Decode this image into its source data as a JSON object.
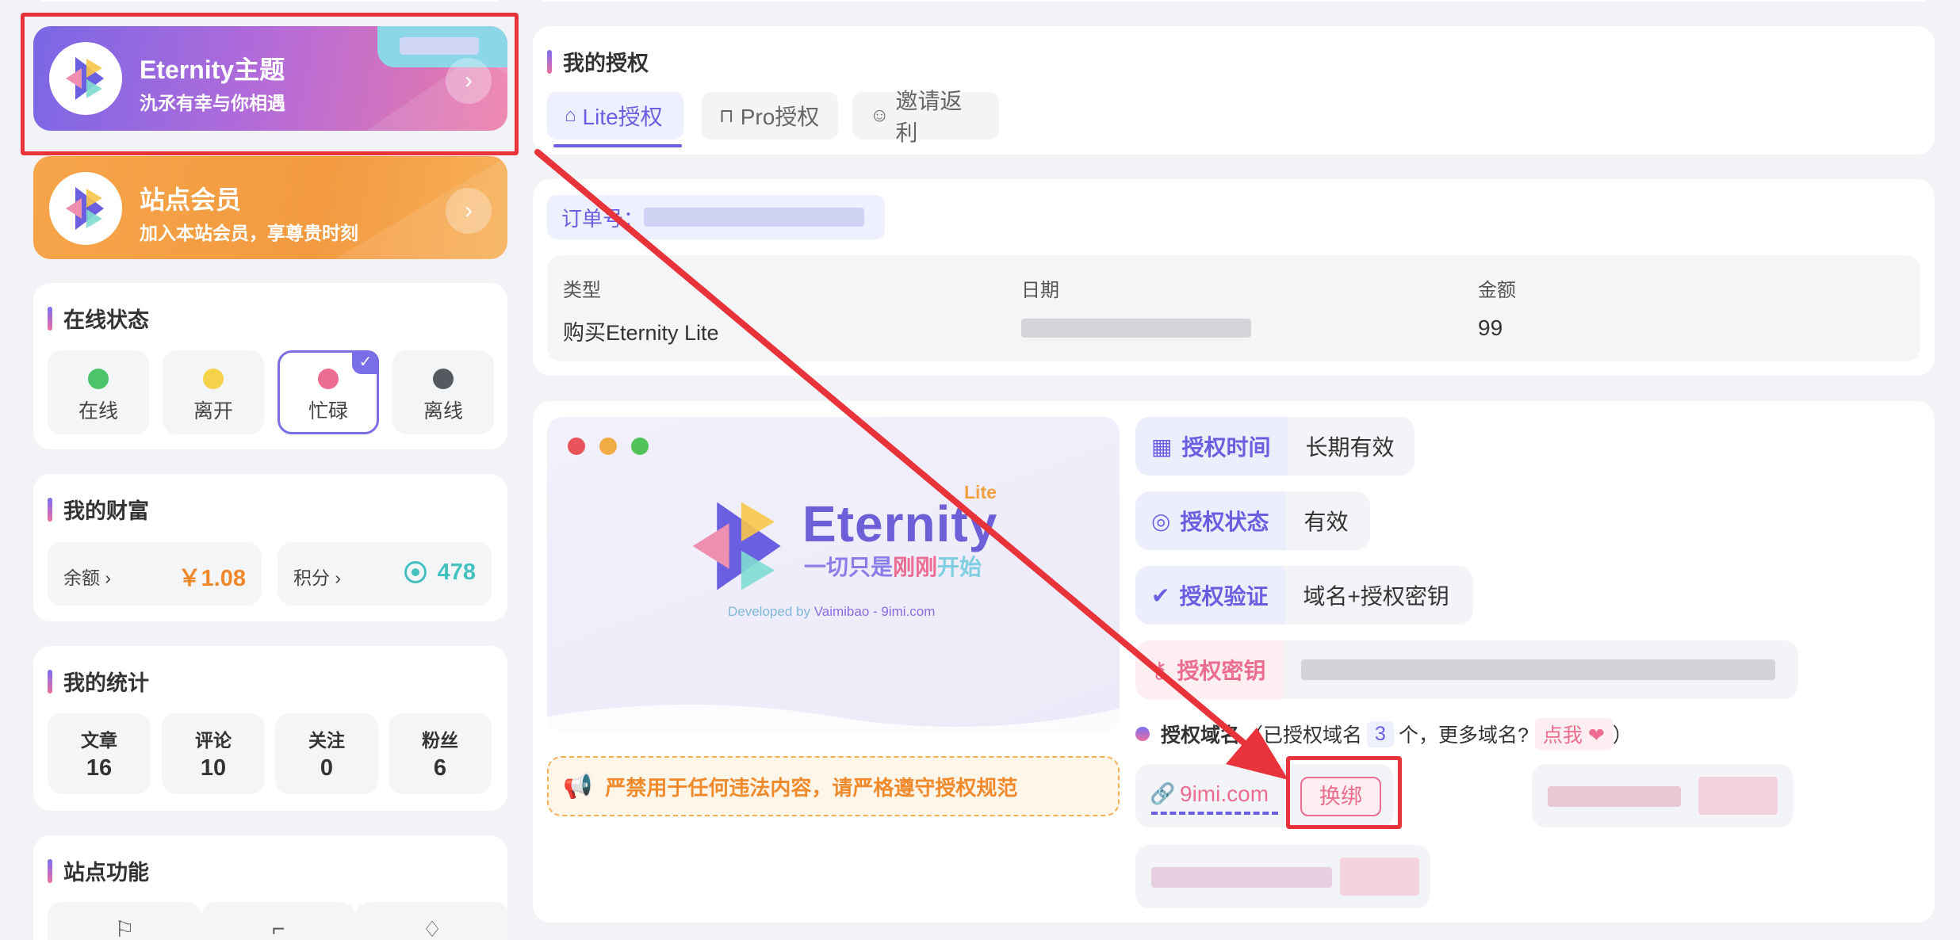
{
  "left": {
    "theme_card": {
      "title": "Eternity主题",
      "subtitle": "氿氶有幸与你相遇",
      "go": "›"
    },
    "member_card": {
      "title": "站点会员",
      "subtitle": "加入本站会员，享尊贵时刻",
      "go": "›"
    },
    "online_status": {
      "title": "在线状态",
      "items": [
        {
          "label": "在线",
          "color": "#4cc46a"
        },
        {
          "label": "离开",
          "color": "#f6d24a"
        },
        {
          "label": "忙碌",
          "color": "#ec6c92"
        },
        {
          "label": "离线",
          "color": "#555a60"
        }
      ]
    },
    "wealth": {
      "title": "我的财富",
      "balance_label": "余额 ›",
      "balance_value": "￥1.08",
      "points_label": "积分 ›",
      "points_value": "478"
    },
    "stats": {
      "title": "我的统计",
      "items": [
        {
          "label": "文章",
          "value": "16"
        },
        {
          "label": "评论",
          "value": "10"
        },
        {
          "label": "关注",
          "value": "0"
        },
        {
          "label": "粉丝",
          "value": "6"
        }
      ]
    },
    "functions": {
      "title": "站点功能"
    }
  },
  "right": {
    "auth_title": "我的授权",
    "tabs": [
      {
        "label": "Lite授权",
        "active": true
      },
      {
        "label": "Pro授权",
        "active": false
      },
      {
        "label": "邀请返利",
        "active": false
      }
    ],
    "order": {
      "label": "订单号：",
      "headers": [
        "类型",
        "日期",
        "金额"
      ],
      "row": {
        "type": "购买Eternity Lite",
        "amount": "99"
      }
    },
    "preview": {
      "brand": "Eternity",
      "edition": "Lite",
      "tagline_a": "一切只是",
      "tagline_b": "刚刚",
      "tagline_c": "开始",
      "developed_by": "Developed by ",
      "developer": "Vaimibao - 9imi.com"
    },
    "warning": "严禁用于任何违法内容，请严格遵守授权规范",
    "license": {
      "time_label": "授权时间",
      "time_value": "长期有效",
      "status_label": "授权状态",
      "status_value": "有效",
      "verify_label": "授权验证",
      "verify_value": "域名+授权密钥",
      "key_label": "授权密钥",
      "domains_label": "授权域名",
      "domains_note_a": "（已授权域名",
      "domains_count": "3",
      "domains_note_b": "个，更多域名?",
      "more_link": "点我",
      "domains_note_c": "）",
      "domain": "9imi.com",
      "rebind": "换绑"
    }
  }
}
